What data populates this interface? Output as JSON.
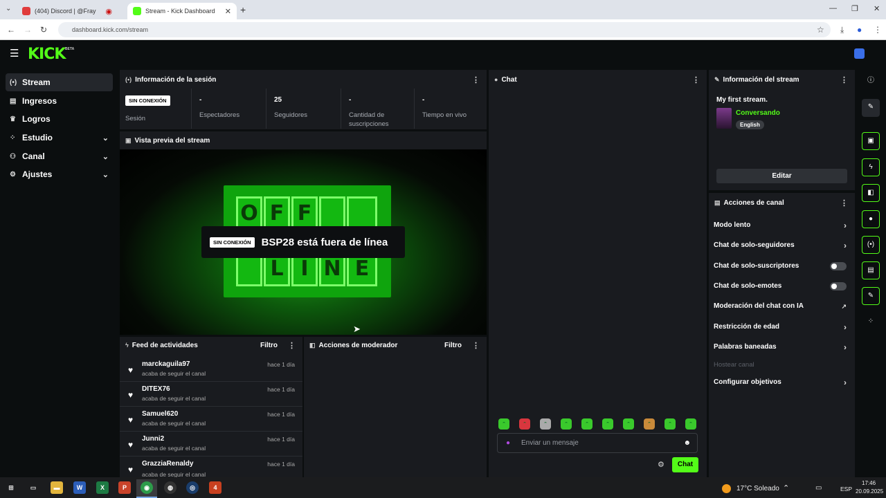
{
  "browser": {
    "tabs": [
      {
        "title": "(404) Discord | @Fray",
        "active": false
      },
      {
        "title": "Stream - Kick Dashboard",
        "active": true
      }
    ],
    "new_tab": "+",
    "url": "dashboard.kick.com/stream"
  },
  "app": {
    "logo": "KICK",
    "logo_tag": "BETA"
  },
  "sidebar": {
    "items": [
      {
        "label": "Stream",
        "icon": "stream-icon",
        "active": true
      },
      {
        "label": "Ingresos",
        "icon": "income-icon"
      },
      {
        "label": "Logros",
        "icon": "trophy-icon"
      },
      {
        "label": "Estudio",
        "icon": "studio-icon",
        "expandable": true
      },
      {
        "label": "Canal",
        "icon": "channel-icon",
        "expandable": true
      },
      {
        "label": "Ajustes",
        "icon": "gear-icon",
        "expandable": true
      }
    ]
  },
  "session": {
    "title": "Información de la sesión",
    "badge": "SIN CONEXIÓN",
    "session_label": "Sesión",
    "stats": [
      {
        "value": "-",
        "label": "Espectadores"
      },
      {
        "value": "25",
        "label": "Seguidores"
      },
      {
        "value": "-",
        "label": "Cantidad de suscripciones"
      },
      {
        "value": "-",
        "label": "Tiempo en vivo"
      }
    ]
  },
  "preview": {
    "title": "Vista previa del stream",
    "sign_top": [
      "O",
      "F",
      "F",
      "",
      ""
    ],
    "sign_bottom": [
      "",
      "L",
      "I",
      "N",
      "E"
    ],
    "badge": "SIN CONEXIÓN",
    "message": "BSP28 está fuera de línea"
  },
  "activity": {
    "title": "Feed de actividades",
    "filter": "Filtro",
    "items": [
      {
        "name": "marckaguila97",
        "desc": "acaba de seguir el canal",
        "time": "hace 1 día"
      },
      {
        "name": "DITEX76",
        "desc": "acaba de seguir el canal",
        "time": "hace 1 día"
      },
      {
        "name": "Samuel620",
        "desc": "acaba de seguir el canal",
        "time": "hace 1 día"
      },
      {
        "name": "Junni2",
        "desc": "acaba de seguir el canal",
        "time": "hace 1 día"
      },
      {
        "name": "GrazziaRenaldy",
        "desc": "acaba de seguir el canal",
        "time": "hace 1 día"
      }
    ]
  },
  "moderator": {
    "title": "Acciones de moderador",
    "filter": "Filtro"
  },
  "chat": {
    "title": "Chat",
    "placeholder": "Enviar un mensaje",
    "send": "Chat"
  },
  "stream_info": {
    "title": "Información del stream",
    "stream_title": "My first stream.",
    "category": "Conversando",
    "language": "English",
    "edit": "Editar"
  },
  "channel_actions": {
    "title": "Acciones de canal",
    "items": [
      {
        "label": "Modo lento",
        "control": "chevron"
      },
      {
        "label": "Chat de solo-seguidores",
        "control": "chevron"
      },
      {
        "label": "Chat de solo-suscriptores",
        "control": "toggle"
      },
      {
        "label": "Chat de solo-emotes",
        "control": "toggle"
      },
      {
        "label": "Moderación del chat con IA",
        "control": "external"
      },
      {
        "label": "Restricción de edad",
        "control": "chevron"
      },
      {
        "label": "Palabras baneadas",
        "control": "chevron"
      },
      {
        "label": "Hostear canal",
        "control": "none",
        "disabled": true
      },
      {
        "label": "Configurar objetivos",
        "control": "chevron"
      }
    ]
  },
  "taskbar": {
    "weather": "17°C Soleado",
    "lang": "ESP",
    "time": "17:46",
    "date": "20.09.2025"
  },
  "colors": {
    "accent": "#53fc18",
    "panel": "#191b1f",
    "background": "#0b0e0f"
  }
}
